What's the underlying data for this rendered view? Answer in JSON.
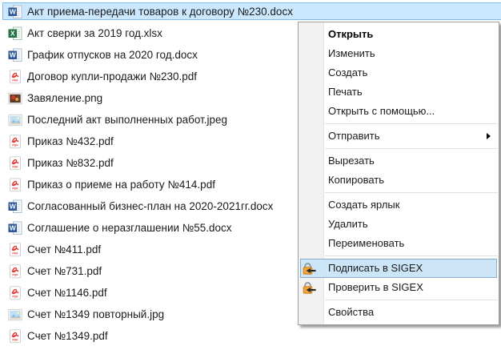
{
  "colors": {
    "selection_fill": "#cce8ff",
    "selection_border": "#7db8ee",
    "menu_highlight_fill": "#cde6f7",
    "menu_highlight_border": "#84aed0",
    "menu_border": "#a0a0a0",
    "sigex_lock_orange": "#f2a33c"
  },
  "files": [
    {
      "name": "Акт приема-передачи товаров к договору №230.docx",
      "icon": "word",
      "selected": true
    },
    {
      "name": "Акт сверки за 2019 год.xlsx",
      "icon": "excel",
      "selected": false
    },
    {
      "name": "График отпусков на 2020 год.docx",
      "icon": "word",
      "selected": false
    },
    {
      "name": "Договор купли-продажи №230.pdf",
      "icon": "pdf",
      "selected": false
    },
    {
      "name": "Завяление.png",
      "icon": "png",
      "selected": false
    },
    {
      "name": "Последний акт выполненных работ.jpeg",
      "icon": "jpeg",
      "selected": false
    },
    {
      "name": "Приказ №432.pdf",
      "icon": "pdf",
      "selected": false
    },
    {
      "name": "Приказ №832.pdf",
      "icon": "pdf",
      "selected": false
    },
    {
      "name": "Приказ о приеме на работу №414.pdf",
      "icon": "pdf",
      "selected": false
    },
    {
      "name": "Согласованный бизнес-план на 2020-2021гг.docx",
      "icon": "word",
      "selected": false
    },
    {
      "name": "Соглашение о неразглашении №55.docx",
      "icon": "word",
      "selected": false
    },
    {
      "name": "Счет №411.pdf",
      "icon": "pdf",
      "selected": false
    },
    {
      "name": "Счет №731.pdf",
      "icon": "pdf",
      "selected": false
    },
    {
      "name": "Счет №1146.pdf",
      "icon": "pdf",
      "selected": false
    },
    {
      "name": "Счет №1349 повторный.jpg",
      "icon": "jpeg",
      "selected": false
    },
    {
      "name": "Счет №1349.pdf",
      "icon": "pdf",
      "selected": false
    }
  ],
  "menu": {
    "items": [
      {
        "type": "item",
        "id": "open",
        "label": "Открыть",
        "bold": true
      },
      {
        "type": "item",
        "id": "edit",
        "label": "Изменить"
      },
      {
        "type": "item",
        "id": "new",
        "label": "Создать"
      },
      {
        "type": "item",
        "id": "print",
        "label": "Печать"
      },
      {
        "type": "item",
        "id": "open-with",
        "label": "Открыть с помощью..."
      },
      {
        "type": "separator"
      },
      {
        "type": "item",
        "id": "send-to",
        "label": "Отправить",
        "submenu": true
      },
      {
        "type": "separator"
      },
      {
        "type": "item",
        "id": "cut",
        "label": "Вырезать"
      },
      {
        "type": "item",
        "id": "copy",
        "label": "Копировать"
      },
      {
        "type": "separator"
      },
      {
        "type": "item",
        "id": "create-shortcut",
        "label": "Создать ярлык"
      },
      {
        "type": "item",
        "id": "delete",
        "label": "Удалить"
      },
      {
        "type": "item",
        "id": "rename",
        "label": "Переименовать"
      },
      {
        "type": "separator"
      },
      {
        "type": "item",
        "id": "sign-in-sigex",
        "label": "Подписать в SIGEX",
        "icon": "sigex",
        "highlighted": true
      },
      {
        "type": "item",
        "id": "verify-in-sigex",
        "label": "Проверить в SIGEX",
        "icon": "sigex"
      },
      {
        "type": "separator"
      },
      {
        "type": "item",
        "id": "properties",
        "label": "Свойства"
      }
    ]
  }
}
